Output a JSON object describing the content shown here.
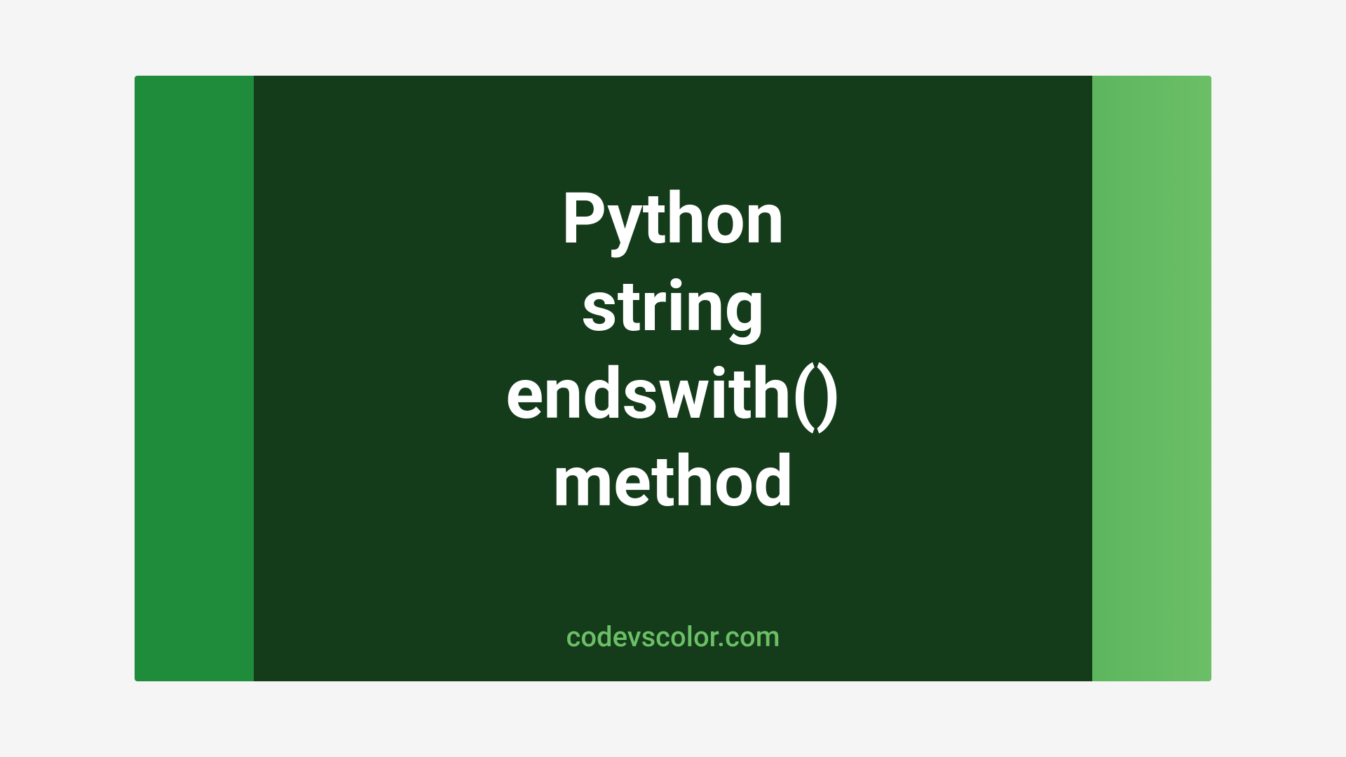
{
  "card": {
    "title": "Python\nstring\nendswith()\nmethod",
    "watermark": "codevscolor.com"
  },
  "colors": {
    "gradient_start": "#1f8c3c",
    "gradient_end": "#6bbf66",
    "blob": "#143b1a",
    "title_text": "#ffffff",
    "watermark_text": "#6bbf66"
  }
}
